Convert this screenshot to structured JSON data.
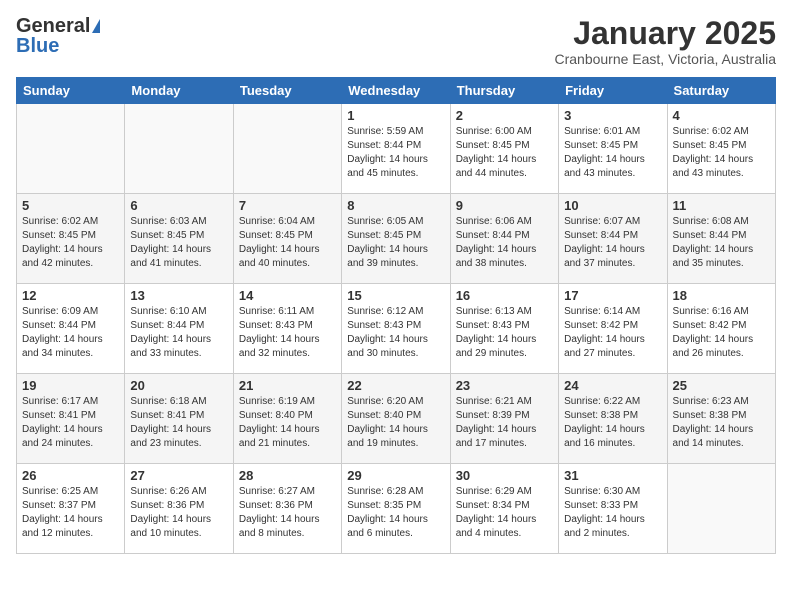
{
  "header": {
    "logo_general": "General",
    "logo_blue": "Blue",
    "month_title": "January 2025",
    "location": "Cranbourne East, Victoria, Australia"
  },
  "weekdays": [
    "Sunday",
    "Monday",
    "Tuesday",
    "Wednesday",
    "Thursday",
    "Friday",
    "Saturday"
  ],
  "weeks": [
    [
      {
        "day": "",
        "sunrise": "",
        "sunset": "",
        "daylight": ""
      },
      {
        "day": "",
        "sunrise": "",
        "sunset": "",
        "daylight": ""
      },
      {
        "day": "",
        "sunrise": "",
        "sunset": "",
        "daylight": ""
      },
      {
        "day": "1",
        "sunrise": "Sunrise: 5:59 AM",
        "sunset": "Sunset: 8:44 PM",
        "daylight": "Daylight: 14 hours and 45 minutes."
      },
      {
        "day": "2",
        "sunrise": "Sunrise: 6:00 AM",
        "sunset": "Sunset: 8:45 PM",
        "daylight": "Daylight: 14 hours and 44 minutes."
      },
      {
        "day": "3",
        "sunrise": "Sunrise: 6:01 AM",
        "sunset": "Sunset: 8:45 PM",
        "daylight": "Daylight: 14 hours and 43 minutes."
      },
      {
        "day": "4",
        "sunrise": "Sunrise: 6:02 AM",
        "sunset": "Sunset: 8:45 PM",
        "daylight": "Daylight: 14 hours and 43 minutes."
      }
    ],
    [
      {
        "day": "5",
        "sunrise": "Sunrise: 6:02 AM",
        "sunset": "Sunset: 8:45 PM",
        "daylight": "Daylight: 14 hours and 42 minutes."
      },
      {
        "day": "6",
        "sunrise": "Sunrise: 6:03 AM",
        "sunset": "Sunset: 8:45 PM",
        "daylight": "Daylight: 14 hours and 41 minutes."
      },
      {
        "day": "7",
        "sunrise": "Sunrise: 6:04 AM",
        "sunset": "Sunset: 8:45 PM",
        "daylight": "Daylight: 14 hours and 40 minutes."
      },
      {
        "day": "8",
        "sunrise": "Sunrise: 6:05 AM",
        "sunset": "Sunset: 8:45 PM",
        "daylight": "Daylight: 14 hours and 39 minutes."
      },
      {
        "day": "9",
        "sunrise": "Sunrise: 6:06 AM",
        "sunset": "Sunset: 8:44 PM",
        "daylight": "Daylight: 14 hours and 38 minutes."
      },
      {
        "day": "10",
        "sunrise": "Sunrise: 6:07 AM",
        "sunset": "Sunset: 8:44 PM",
        "daylight": "Daylight: 14 hours and 37 minutes."
      },
      {
        "day": "11",
        "sunrise": "Sunrise: 6:08 AM",
        "sunset": "Sunset: 8:44 PM",
        "daylight": "Daylight: 14 hours and 35 minutes."
      }
    ],
    [
      {
        "day": "12",
        "sunrise": "Sunrise: 6:09 AM",
        "sunset": "Sunset: 8:44 PM",
        "daylight": "Daylight: 14 hours and 34 minutes."
      },
      {
        "day": "13",
        "sunrise": "Sunrise: 6:10 AM",
        "sunset": "Sunset: 8:44 PM",
        "daylight": "Daylight: 14 hours and 33 minutes."
      },
      {
        "day": "14",
        "sunrise": "Sunrise: 6:11 AM",
        "sunset": "Sunset: 8:43 PM",
        "daylight": "Daylight: 14 hours and 32 minutes."
      },
      {
        "day": "15",
        "sunrise": "Sunrise: 6:12 AM",
        "sunset": "Sunset: 8:43 PM",
        "daylight": "Daylight: 14 hours and 30 minutes."
      },
      {
        "day": "16",
        "sunrise": "Sunrise: 6:13 AM",
        "sunset": "Sunset: 8:43 PM",
        "daylight": "Daylight: 14 hours and 29 minutes."
      },
      {
        "day": "17",
        "sunrise": "Sunrise: 6:14 AM",
        "sunset": "Sunset: 8:42 PM",
        "daylight": "Daylight: 14 hours and 27 minutes."
      },
      {
        "day": "18",
        "sunrise": "Sunrise: 6:16 AM",
        "sunset": "Sunset: 8:42 PM",
        "daylight": "Daylight: 14 hours and 26 minutes."
      }
    ],
    [
      {
        "day": "19",
        "sunrise": "Sunrise: 6:17 AM",
        "sunset": "Sunset: 8:41 PM",
        "daylight": "Daylight: 14 hours and 24 minutes."
      },
      {
        "day": "20",
        "sunrise": "Sunrise: 6:18 AM",
        "sunset": "Sunset: 8:41 PM",
        "daylight": "Daylight: 14 hours and 23 minutes."
      },
      {
        "day": "21",
        "sunrise": "Sunrise: 6:19 AM",
        "sunset": "Sunset: 8:40 PM",
        "daylight": "Daylight: 14 hours and 21 minutes."
      },
      {
        "day": "22",
        "sunrise": "Sunrise: 6:20 AM",
        "sunset": "Sunset: 8:40 PM",
        "daylight": "Daylight: 14 hours and 19 minutes."
      },
      {
        "day": "23",
        "sunrise": "Sunrise: 6:21 AM",
        "sunset": "Sunset: 8:39 PM",
        "daylight": "Daylight: 14 hours and 17 minutes."
      },
      {
        "day": "24",
        "sunrise": "Sunrise: 6:22 AM",
        "sunset": "Sunset: 8:38 PM",
        "daylight": "Daylight: 14 hours and 16 minutes."
      },
      {
        "day": "25",
        "sunrise": "Sunrise: 6:23 AM",
        "sunset": "Sunset: 8:38 PM",
        "daylight": "Daylight: 14 hours and 14 minutes."
      }
    ],
    [
      {
        "day": "26",
        "sunrise": "Sunrise: 6:25 AM",
        "sunset": "Sunset: 8:37 PM",
        "daylight": "Daylight: 14 hours and 12 minutes."
      },
      {
        "day": "27",
        "sunrise": "Sunrise: 6:26 AM",
        "sunset": "Sunset: 8:36 PM",
        "daylight": "Daylight: 14 hours and 10 minutes."
      },
      {
        "day": "28",
        "sunrise": "Sunrise: 6:27 AM",
        "sunset": "Sunset: 8:36 PM",
        "daylight": "Daylight: 14 hours and 8 minutes."
      },
      {
        "day": "29",
        "sunrise": "Sunrise: 6:28 AM",
        "sunset": "Sunset: 8:35 PM",
        "daylight": "Daylight: 14 hours and 6 minutes."
      },
      {
        "day": "30",
        "sunrise": "Sunrise: 6:29 AM",
        "sunset": "Sunset: 8:34 PM",
        "daylight": "Daylight: 14 hours and 4 minutes."
      },
      {
        "day": "31",
        "sunrise": "Sunrise: 6:30 AM",
        "sunset": "Sunset: 8:33 PM",
        "daylight": "Daylight: 14 hours and 2 minutes."
      },
      {
        "day": "",
        "sunrise": "",
        "sunset": "",
        "daylight": ""
      }
    ]
  ]
}
